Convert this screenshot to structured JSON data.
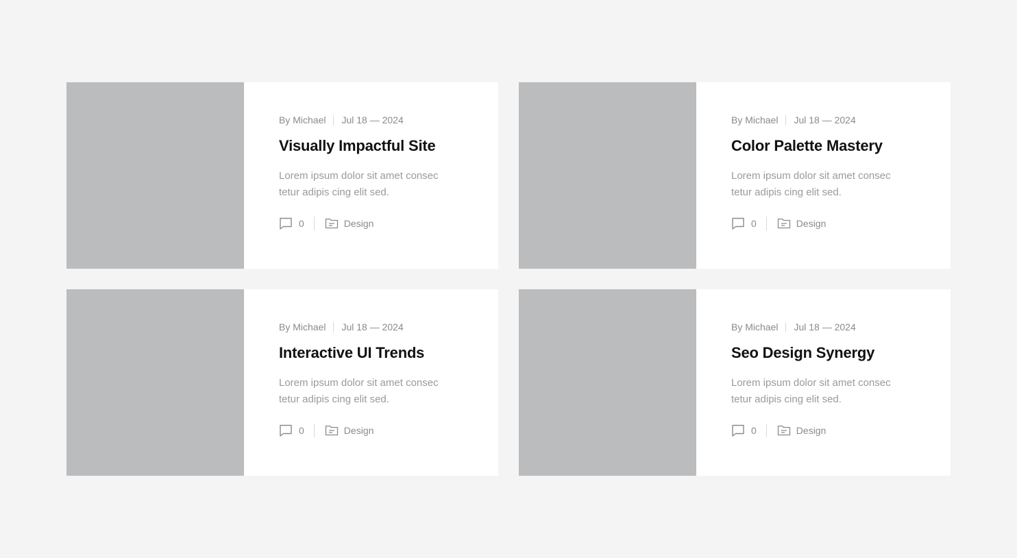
{
  "posts": [
    {
      "author": "By Michael",
      "date": "Jul 18 — 2024",
      "title": "Visually Impactful Site",
      "excerpt": "Lorem ipsum dolor sit amet consec tetur adipis cing elit sed.",
      "comments": "0",
      "category": "Design"
    },
    {
      "author": "By Michael",
      "date": "Jul 18 — 2024",
      "title": "Color Palette Mastery",
      "excerpt": "Lorem ipsum dolor sit amet consec tetur adipis cing elit sed.",
      "comments": "0",
      "category": "Design"
    },
    {
      "author": "By Michael",
      "date": "Jul 18 — 2024",
      "title": "Interactive UI Trends",
      "excerpt": "Lorem ipsum dolor sit amet consec tetur adipis cing elit sed.",
      "comments": "0",
      "category": "Design"
    },
    {
      "author": "By Michael",
      "date": "Jul 18 — 2024",
      "title": "Seo Design Synergy",
      "excerpt": "Lorem ipsum dolor sit amet consec tetur adipis cing elit sed.",
      "comments": "0",
      "category": "Design"
    }
  ],
  "icons": {
    "comment": "comment-icon",
    "category": "folder-icon"
  },
  "colors": {
    "background": "#f4f4f4",
    "card": "#ffffff",
    "thumbnail": "#bbbcbd",
    "title": "#111111",
    "meta": "#8a8a8a"
  }
}
